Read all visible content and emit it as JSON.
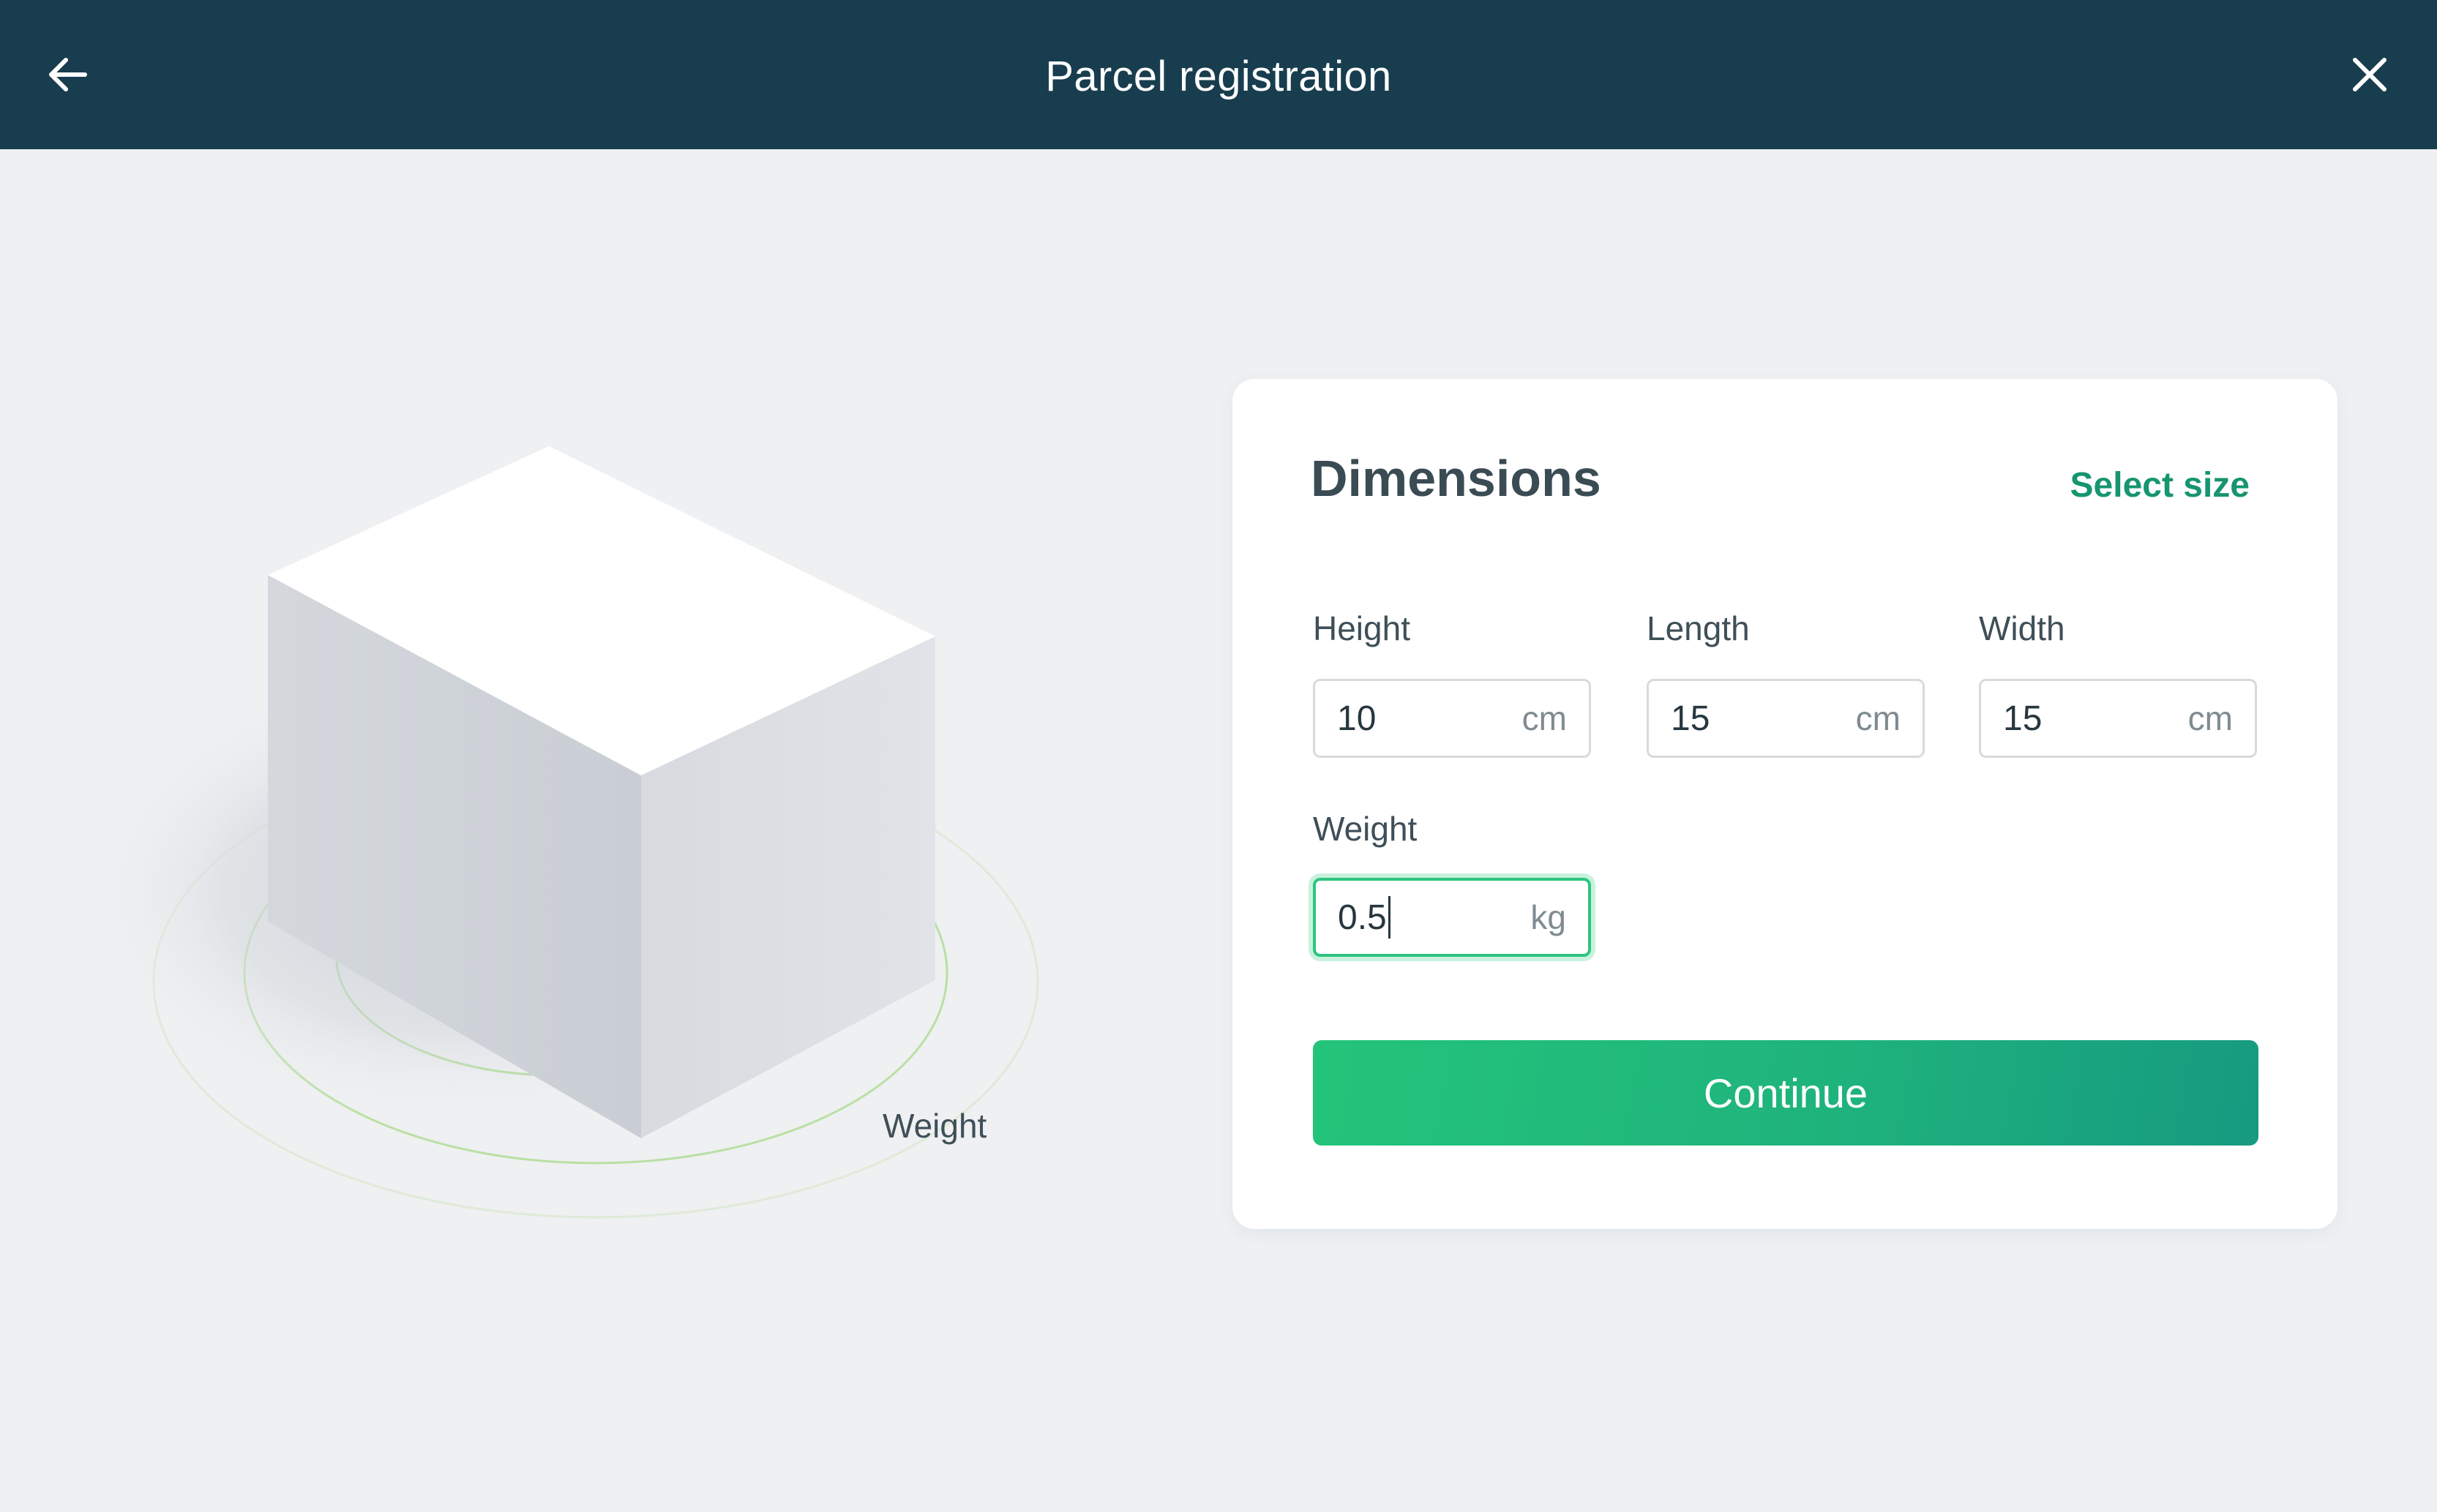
{
  "header": {
    "title": "Parcel registration",
    "back_icon": "arrow-left-icon",
    "close_icon": "close-icon",
    "background": "#183d4e"
  },
  "illustration": {
    "icon": "parcel-box-icon",
    "label": "Weight"
  },
  "dimensions": {
    "title": "Dimensions",
    "select_size_label": "Select size",
    "fields": {
      "height": {
        "label": "Height",
        "value": "10",
        "unit": "cm"
      },
      "length": {
        "label": "Length",
        "value": "15",
        "unit": "cm"
      },
      "width": {
        "label": "Width",
        "value": "15",
        "unit": "cm"
      },
      "weight": {
        "label": "Weight",
        "value": "0.5",
        "unit": "kg",
        "focused": true
      }
    },
    "continue_label": "Continue"
  },
  "colors": {
    "accent": "#16956f",
    "button_start": "#23c47a",
    "button_end": "#169a80",
    "focus_ring": "#2dc57f",
    "page_background": "#eff0f2"
  }
}
